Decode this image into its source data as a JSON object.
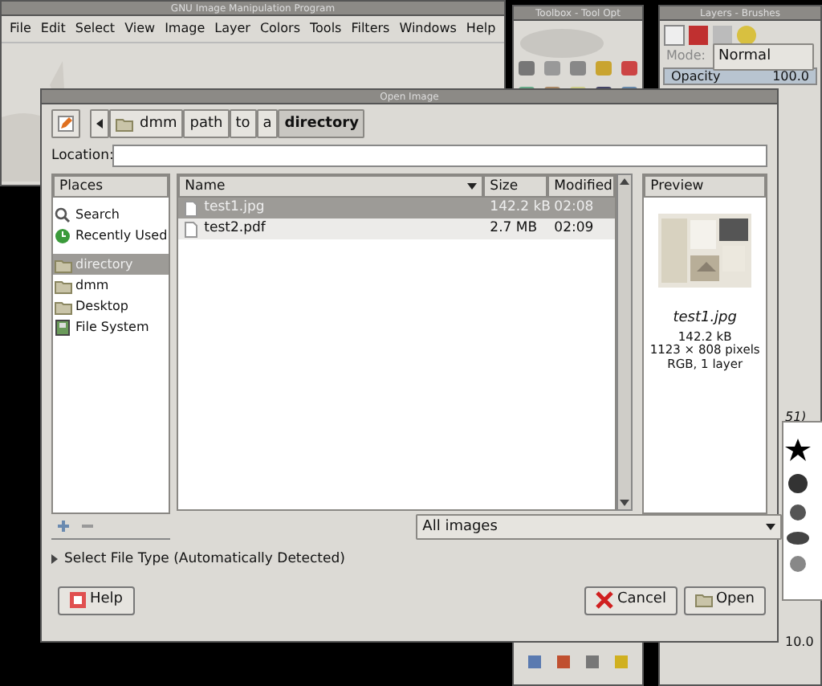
{
  "main_window": {
    "title": "GNU Image Manipulation Program",
    "menu": [
      "File",
      "Edit",
      "Select",
      "View",
      "Image",
      "Layer",
      "Colors",
      "Tools",
      "Filters",
      "Windows",
      "Help"
    ]
  },
  "toolbox": {
    "title": "Toolbox - Tool Opt"
  },
  "layers": {
    "title": "Layers - Brushes",
    "mode_label": "Mode:",
    "mode": "Normal",
    "opacity_label": "Opacity",
    "opacity": "100.0",
    "brushes_title": "51)",
    "spacing": "10.0"
  },
  "dialog": {
    "title": "Open Image",
    "path": [
      {
        "label": "dmm",
        "folder": true,
        "selected": false
      },
      {
        "label": "path",
        "folder": false,
        "selected": false
      },
      {
        "label": "to",
        "folder": false,
        "selected": false
      },
      {
        "label": "a",
        "folder": false,
        "selected": false
      },
      {
        "label": "directory",
        "folder": false,
        "selected": true
      }
    ],
    "location_label": "Location:",
    "places": {
      "header": "Places",
      "items": [
        {
          "label": "Search",
          "kind": "search",
          "selected": false
        },
        {
          "label": "Recently Used",
          "kind": "recent",
          "selected": false
        },
        {
          "label": "directory",
          "kind": "folder",
          "selected": true
        },
        {
          "label": "dmm",
          "kind": "folder",
          "selected": false
        },
        {
          "label": "Desktop",
          "kind": "folder",
          "selected": false
        },
        {
          "label": "File System",
          "kind": "drive",
          "selected": false
        }
      ]
    },
    "files": {
      "columns": [
        "Name",
        "Size",
        "Modified"
      ],
      "rows": [
        {
          "name": "test1.jpg",
          "size": "142.2 kB",
          "modified": "02:08",
          "selected": true
        },
        {
          "name": "test2.pdf",
          "size": "2.7 MB",
          "modified": "02:09",
          "selected": false
        }
      ]
    },
    "preview": {
      "header": "Preview",
      "filename": "test1.jpg",
      "lines": [
        "142.2 kB",
        "1123 × 808 pixels",
        "RGB, 1 layer"
      ]
    },
    "filter": "All images",
    "expander": "Select File Type (Automatically Detected)",
    "buttons": [
      {
        "label": "Help",
        "kind": "help"
      },
      {
        "label": "Cancel",
        "kind": "cancel"
      },
      {
        "label": "Open",
        "kind": "open"
      }
    ]
  }
}
